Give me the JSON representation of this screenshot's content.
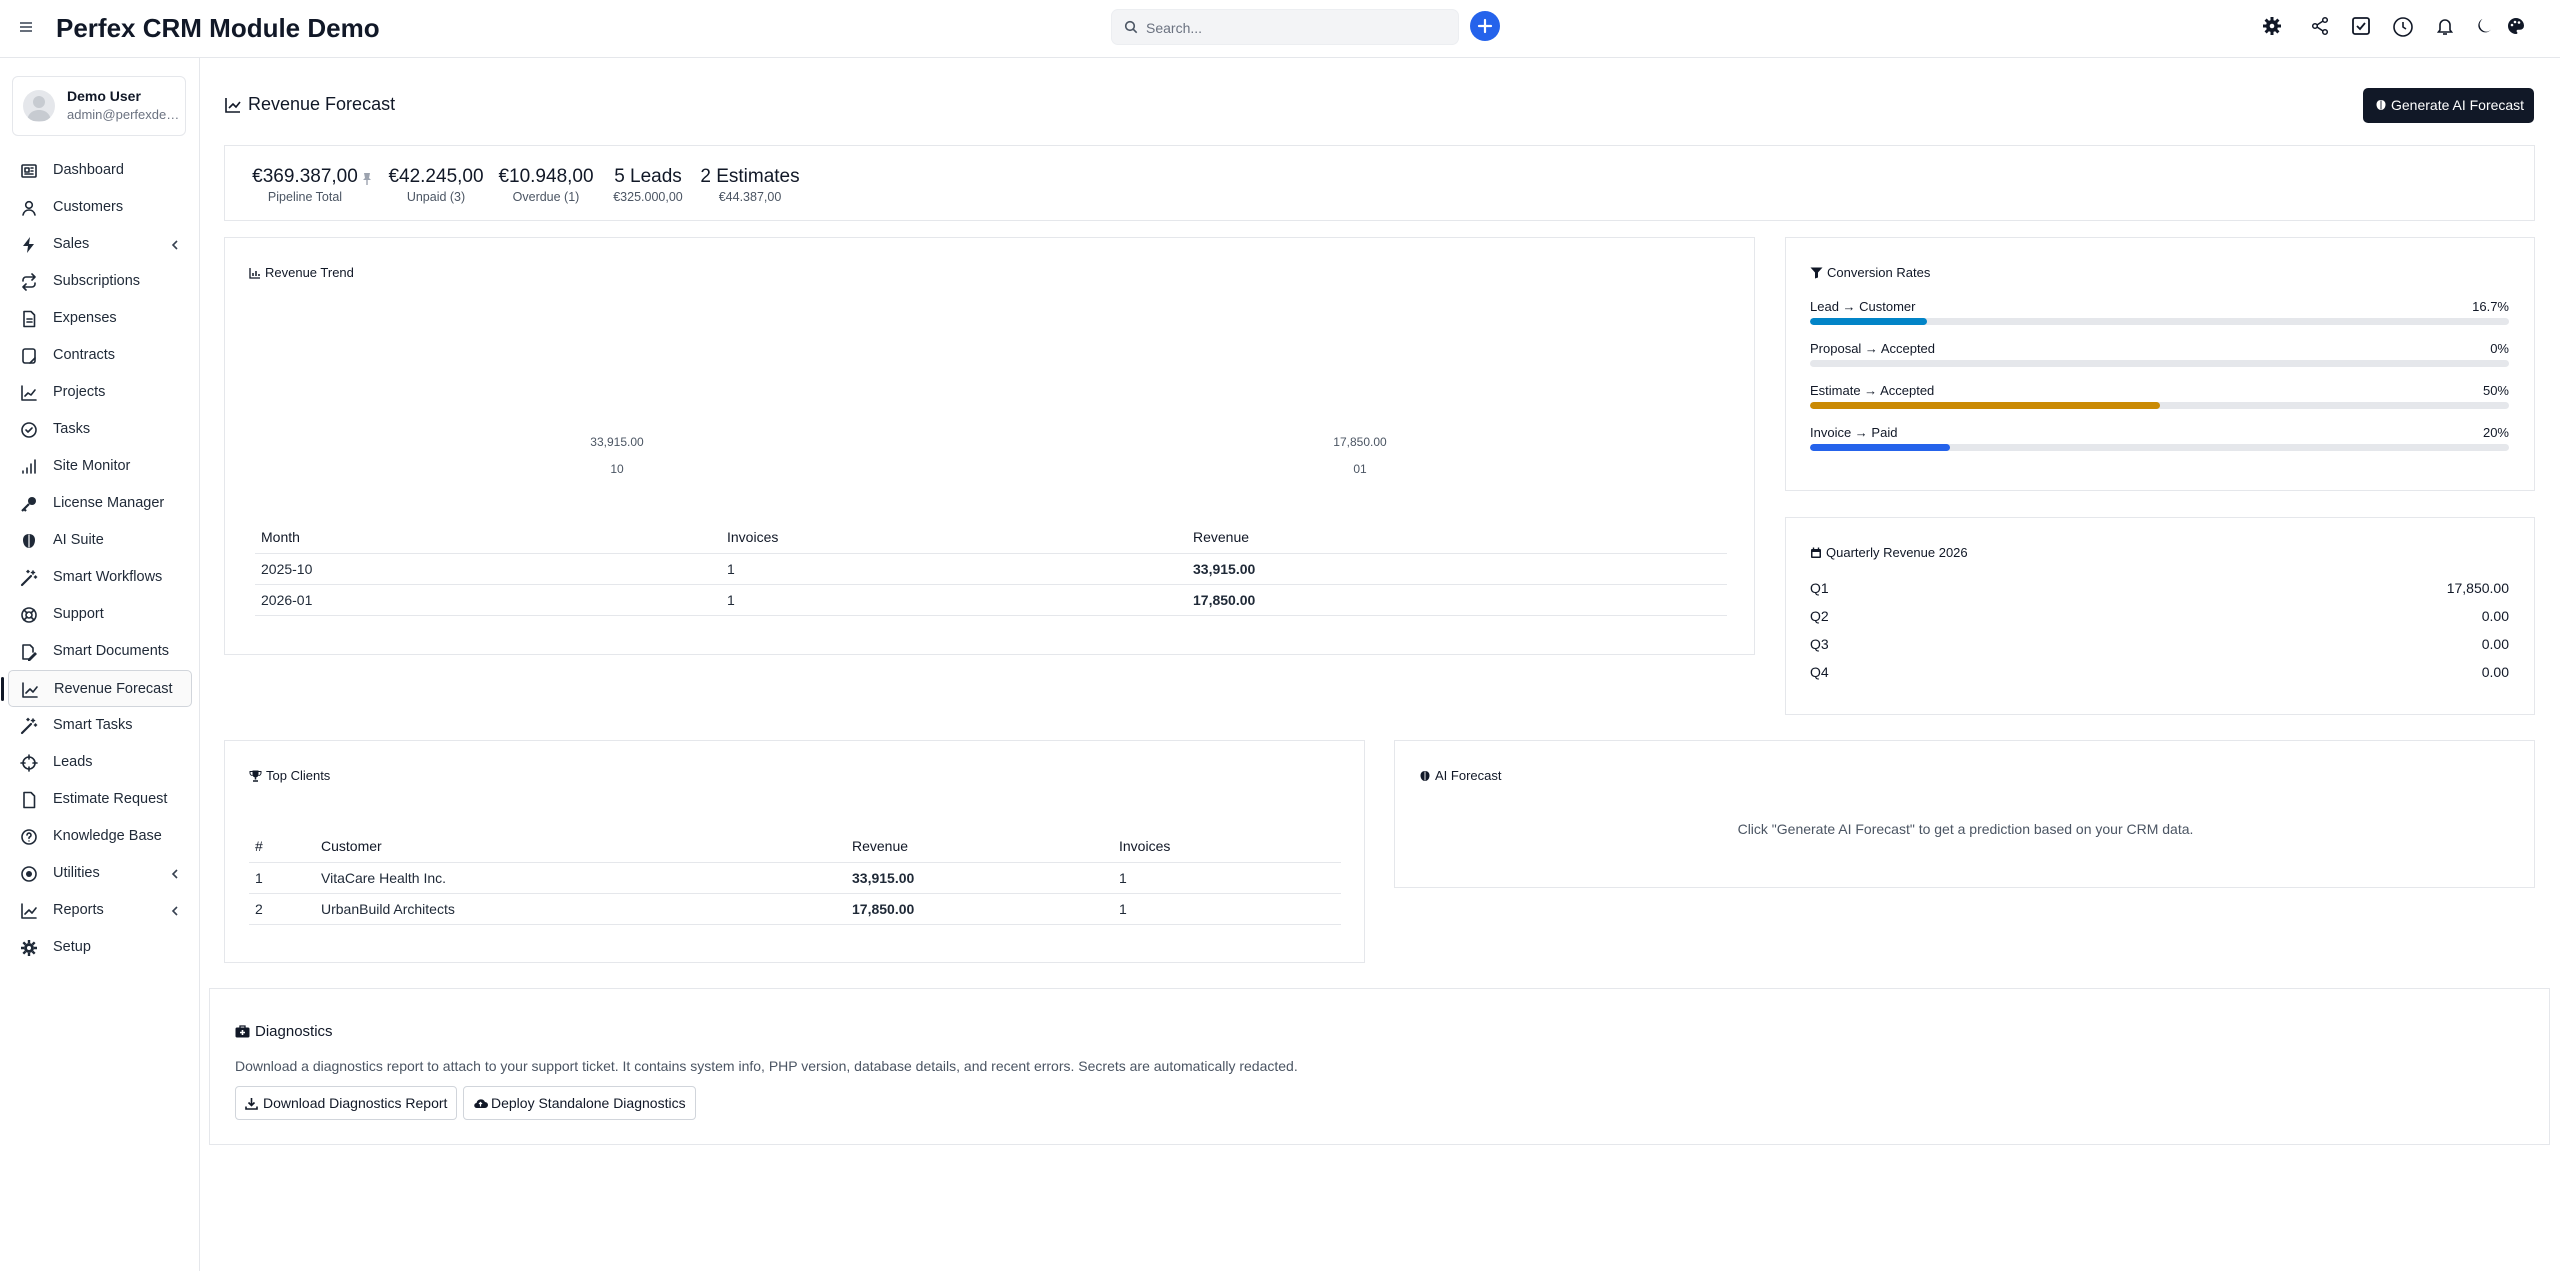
{
  "header": {
    "app_title": "Perfex CRM Module Demo",
    "search_placeholder": "Search..."
  },
  "user": {
    "name": "Demo User",
    "email": "admin@perfexdemo.com"
  },
  "sidebar": {
    "items": [
      {
        "label": "Dashboard",
        "icon": "dashboard-icon"
      },
      {
        "label": "Customers",
        "icon": "user-icon"
      },
      {
        "label": "Sales",
        "icon": "bolt-icon",
        "expandable": true
      },
      {
        "label": "Subscriptions",
        "icon": "repeat-icon"
      },
      {
        "label": "Expenses",
        "icon": "file-text-icon"
      },
      {
        "label": "Contracts",
        "icon": "contract-icon"
      },
      {
        "label": "Projects",
        "icon": "chart-icon"
      },
      {
        "label": "Tasks",
        "icon": "check-circle-icon"
      },
      {
        "label": "Site Monitor",
        "icon": "signal-icon"
      },
      {
        "label": "License Manager",
        "icon": "key-icon"
      },
      {
        "label": "AI Suite",
        "icon": "brain-icon"
      },
      {
        "label": "Smart Workflows",
        "icon": "magic-wand-icon"
      },
      {
        "label": "Support",
        "icon": "lifebuoy-icon"
      },
      {
        "label": "Smart Documents",
        "icon": "document-edit-icon"
      },
      {
        "label": "Revenue Forecast",
        "icon": "line-chart-icon",
        "active": true
      },
      {
        "label": "Smart Tasks",
        "icon": "magic-wand-icon"
      },
      {
        "label": "Leads",
        "icon": "crosshair-icon"
      },
      {
        "label": "Estimate Request",
        "icon": "file-icon"
      },
      {
        "label": "Knowledge Base",
        "icon": "question-circle-icon"
      },
      {
        "label": "Utilities",
        "icon": "dot-circle-icon",
        "expandable": true
      },
      {
        "label": "Reports",
        "icon": "line-chart-icon",
        "expandable": true
      },
      {
        "label": "Setup",
        "icon": "gear-icon"
      }
    ]
  },
  "page": {
    "title": "Revenue Forecast",
    "generate_button": "Generate AI Forecast"
  },
  "stats": [
    {
      "value": "€369.387,00",
      "label": "Pipeline Total"
    },
    {
      "value": "€42.245,00",
      "label": "Unpaid (3)"
    },
    {
      "value": "€10.948,00",
      "label": "Overdue (1)"
    },
    {
      "value": "5 Leads",
      "label": "€325.000,00"
    },
    {
      "value": "2 Estimates",
      "label": "€44.387,00"
    }
  ],
  "revenue_trend": {
    "title": "Revenue Trend",
    "columns": [
      "Month",
      "Invoices",
      "Revenue"
    ],
    "rows": [
      {
        "month": "2025-10",
        "invoices": "1",
        "revenue": "33,915.00"
      },
      {
        "month": "2026-01",
        "invoices": "1",
        "revenue": "17,850.00"
      }
    ]
  },
  "chart_data": {
    "type": "bar",
    "title": "Revenue Trend",
    "categories": [
      "10",
      "01"
    ],
    "values": [
      33915.0,
      17850.0
    ],
    "value_labels": [
      "33,915.00",
      "17,850.00"
    ]
  },
  "conversion": {
    "title": "Conversion Rates",
    "rates": [
      {
        "label": "Lead → Customer",
        "pct_text": "16.7%",
        "pct": 16.7,
        "color": "#0284c7"
      },
      {
        "label": "Proposal → Accepted",
        "pct_text": "0%",
        "pct": 0,
        "color": "#6b7280"
      },
      {
        "label": "Estimate → Accepted",
        "pct_text": "50%",
        "pct": 50,
        "color": "#ca8a04"
      },
      {
        "label": "Invoice → Paid",
        "pct_text": "20%",
        "pct": 20,
        "color": "#2563eb"
      }
    ]
  },
  "quarterly": {
    "title": "Quarterly Revenue 2026",
    "rows": [
      {
        "q": "Q1",
        "value": "17,850.00"
      },
      {
        "q": "Q2",
        "value": "0.00"
      },
      {
        "q": "Q3",
        "value": "0.00"
      },
      {
        "q": "Q4",
        "value": "0.00"
      }
    ]
  },
  "top_clients": {
    "title": "Top Clients",
    "columns": [
      "#",
      "Customer",
      "Revenue",
      "Invoices"
    ],
    "rows": [
      {
        "rank": "1",
        "customer": "VitaCare Health Inc.",
        "revenue": "33,915.00",
        "invoices": "1"
      },
      {
        "rank": "2",
        "customer": "UrbanBuild Architects",
        "revenue": "17,850.00",
        "invoices": "1"
      }
    ]
  },
  "ai_forecast": {
    "title": "AI Forecast",
    "message": "Click \"Generate AI Forecast\" to get a prediction based on your CRM data."
  },
  "diagnostics": {
    "title": "Diagnostics",
    "description": "Download a diagnostics report to attach to your support ticket. It contains system info, PHP version, database details, and recent errors. Secrets are automatically redacted.",
    "download_button": "Download Diagnostics Report",
    "deploy_button": "Deploy Standalone Diagnostics"
  },
  "colors": {
    "accent": "#2563eb",
    "dark_button": "#111827"
  }
}
